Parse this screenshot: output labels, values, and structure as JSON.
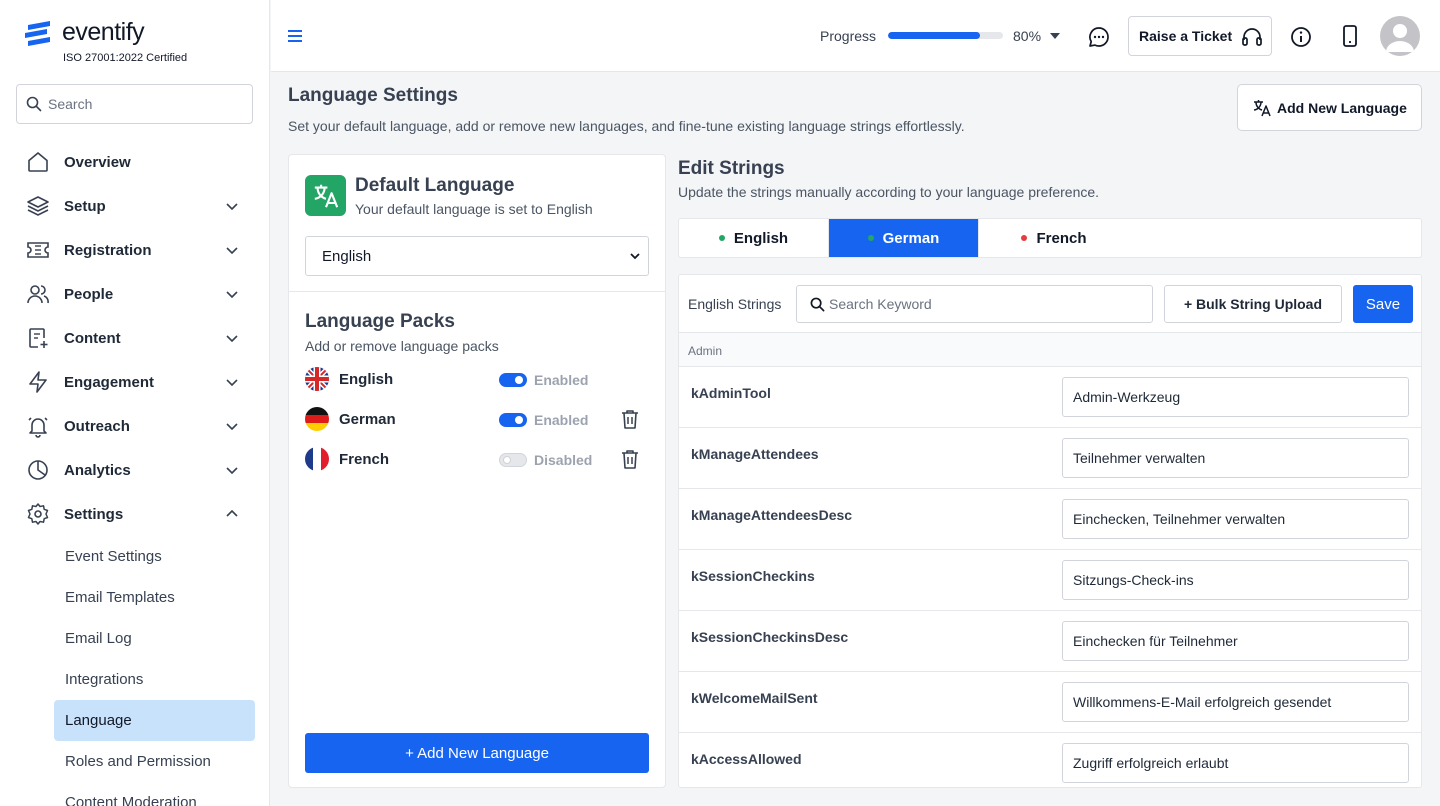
{
  "brand": {
    "name": "eventify",
    "certification": "ISO 27001:2022 Certified",
    "accent": "#1764f0"
  },
  "sidebar": {
    "search_placeholder": "Search",
    "nav": [
      {
        "label": "Overview",
        "icon": "home-icon",
        "expandable": false
      },
      {
        "label": "Setup",
        "icon": "layers-icon",
        "expandable": true
      },
      {
        "label": "Registration",
        "icon": "ticket-icon",
        "expandable": true
      },
      {
        "label": "People",
        "icon": "people-icon",
        "expandable": true
      },
      {
        "label": "Content",
        "icon": "document-add-icon",
        "expandable": true
      },
      {
        "label": "Engagement",
        "icon": "lightning-icon",
        "expandable": true
      },
      {
        "label": "Outreach",
        "icon": "bell-icon",
        "expandable": true
      },
      {
        "label": "Analytics",
        "icon": "pie-chart-icon",
        "expandable": true
      },
      {
        "label": "Settings",
        "icon": "gear-icon",
        "expandable": true,
        "expanded": true
      }
    ],
    "settings_sub": [
      "Event Settings",
      "Email Templates",
      "Email Log",
      "Integrations",
      "Language",
      "Roles and Permission",
      "Content Moderation"
    ],
    "active_sub": "Language"
  },
  "topbar": {
    "progress_label": "Progress",
    "progress_value": 80,
    "progress_text": "80%",
    "ticket_label": "Raise a Ticket"
  },
  "page": {
    "title": "Language Settings",
    "description": "Set your default language, add or remove new languages, and fine-tune existing language strings effortlessly.",
    "add_language_label": "Add New Language"
  },
  "default_language": {
    "title": "Default Language",
    "subtitle": "Your default language is set to English",
    "selected": "English"
  },
  "language_packs": {
    "title": "Language Packs",
    "subtitle": "Add or remove language packs",
    "items": [
      {
        "name": "English",
        "status": "Enabled",
        "enabled": true,
        "flag": "uk-flag-icon",
        "deletable": false
      },
      {
        "name": "German",
        "status": "Enabled",
        "enabled": true,
        "flag": "germany-flag-icon",
        "deletable": true
      },
      {
        "name": "French",
        "status": "Disabled",
        "enabled": false,
        "flag": "france-flag-icon",
        "deletable": true
      }
    ],
    "add_button": "+ Add New Language"
  },
  "edit_strings": {
    "title": "Edit Strings",
    "subtitle": "Update the strings manually according to your language preference.",
    "tabs": [
      {
        "label": "English",
        "dot_color": "#22a565",
        "active": false
      },
      {
        "label": "German",
        "dot_color": "#22a565",
        "active": true
      },
      {
        "label": "French",
        "dot_color": "#e53e3e",
        "active": false
      }
    ],
    "strings_label": "English Strings",
    "search_placeholder": "Search Keyword",
    "bulk_upload_label": "+ Bulk String Upload",
    "save_label": "Save",
    "section": "Admin",
    "rows": [
      {
        "key": "kAdminTool",
        "value": "Admin-Werkzeug"
      },
      {
        "key": "kManageAttendees",
        "value": "Teilnehmer verwalten"
      },
      {
        "key": "kManageAttendeesDesc",
        "value": "Einchecken, Teilnehmer verwalten"
      },
      {
        "key": "kSessionCheckins",
        "value": "Sitzungs-Check-ins"
      },
      {
        "key": "kSessionCheckinsDesc",
        "value": "Einchecken für Teilnehmer"
      },
      {
        "key": "kWelcomeMailSent",
        "value": "Willkommens-E-Mail erfolgreich gesendet"
      },
      {
        "key": "kAccessAllowed",
        "value": "Zugriff erfolgreich erlaubt"
      }
    ]
  }
}
